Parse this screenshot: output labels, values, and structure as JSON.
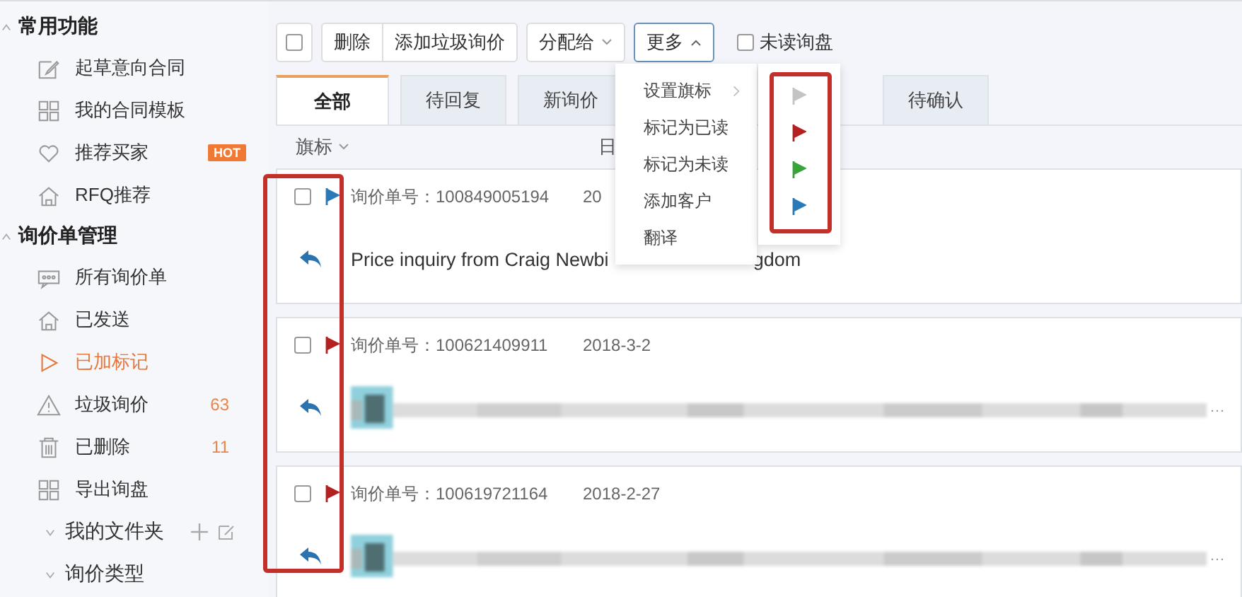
{
  "sidebar": {
    "sections": [
      {
        "title": "常用功能",
        "expanded": true,
        "items": [
          {
            "label": "起草意向合同",
            "selected": false
          },
          {
            "label": "我的合同模板",
            "selected": false
          },
          {
            "label": "推荐买家",
            "selected": false,
            "badge": "HOT"
          },
          {
            "label": "RFQ推荐",
            "selected": false
          }
        ]
      },
      {
        "title": "询价单管理",
        "expanded": true,
        "items": [
          {
            "label": "所有询价单",
            "selected": false
          },
          {
            "label": "已发送",
            "selected": false
          },
          {
            "label": "已加标记",
            "selected": true
          },
          {
            "label": "垃圾询价",
            "selected": false,
            "count": "63"
          },
          {
            "label": "已删除",
            "selected": false,
            "count": "11"
          },
          {
            "label": "导出询盘",
            "selected": false
          }
        ]
      }
    ],
    "folders": [
      {
        "label": "我的文件夹",
        "expanded": false,
        "actions": true
      },
      {
        "label": "询价类型",
        "expanded": false,
        "actions": false
      }
    ]
  },
  "toolbar": {
    "select_all": {
      "checked": false
    },
    "buttons": [
      "删除",
      "添加垃圾询价"
    ],
    "assign": "分配给",
    "more": {
      "label": "更多",
      "expanded": true
    },
    "unread_filter": {
      "label": "未读询盘",
      "checked": false
    }
  },
  "tabs": [
    {
      "label": "全部",
      "selected": true
    },
    {
      "label": "待回复",
      "selected": false
    },
    {
      "label": "新询价",
      "selected": false
    },
    {
      "label": "待确认",
      "selected": false
    }
  ],
  "list_header": {
    "flag_column": "旗标",
    "date_column": "日"
  },
  "inquiries": [
    {
      "checked": false,
      "color": "#2a7ab8",
      "number": "询价单号：100849005194",
      "date": "20",
      "title": "Price inquiry from Craig Newbi",
      "title_tail": "gdom",
      "blurred": false
    },
    {
      "checked": false,
      "color": "#b52020",
      "number": "询价单号：100621409911",
      "date": "2018-3-2",
      "blurred": true,
      "tail": "…"
    },
    {
      "checked": false,
      "color": "#b52020",
      "number": "询价单号：100619721164",
      "date": "2018-2-27",
      "blurred": true,
      "tail": "…"
    }
  ],
  "more_menu": {
    "items": [
      {
        "label": "设置旗标",
        "submenu": true
      },
      {
        "label": "标记为已读",
        "submenu": false
      },
      {
        "label": "标记为未读",
        "submenu": false
      },
      {
        "label": "添加客户",
        "submenu": false
      },
      {
        "label": "翻译",
        "submenu": false
      }
    ],
    "flag_options": [
      {
        "color": "#c4c4c4"
      },
      {
        "color": "#b52020"
      },
      {
        "color": "#3aa43a"
      },
      {
        "color": "#2a7ab8"
      }
    ]
  }
}
